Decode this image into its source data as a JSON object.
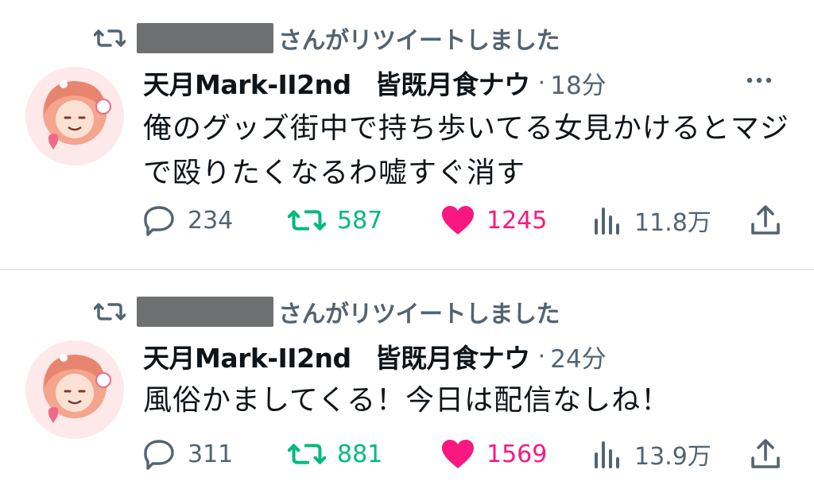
{
  "tweets": [
    {
      "retweet_label": "さんがリツイートしました",
      "author_name": "天月Mark-II2nd",
      "author_handle": "皆既月食ナウ",
      "separator": "·",
      "time": "18分",
      "body": "俺のグッズ街中で持ち歩いてる女見かけるとマジで殴りたくなるわ嘘すぐ消す",
      "replies": "234",
      "retweets": "587",
      "likes": "1245",
      "views": "11.8万"
    },
    {
      "retweet_label": "さんがリツイートしました",
      "author_name": "天月Mark-II2nd",
      "author_handle": "皆既月食ナウ",
      "separator": "·",
      "time": "24分",
      "body": "風俗かましてくる！今日は配信なしね！",
      "replies": "311",
      "retweets": "881",
      "likes": "1569",
      "views": "13.9万"
    }
  ],
  "colors": {
    "text": "#0f1419",
    "secondary": "#536471",
    "retweet_green": "#00ba7c",
    "like_pink": "#f91880",
    "redaction": "#6e7072"
  },
  "icons": [
    "retweet-icon",
    "more-icon",
    "reply-icon",
    "like-icon",
    "views-icon",
    "share-icon"
  ]
}
